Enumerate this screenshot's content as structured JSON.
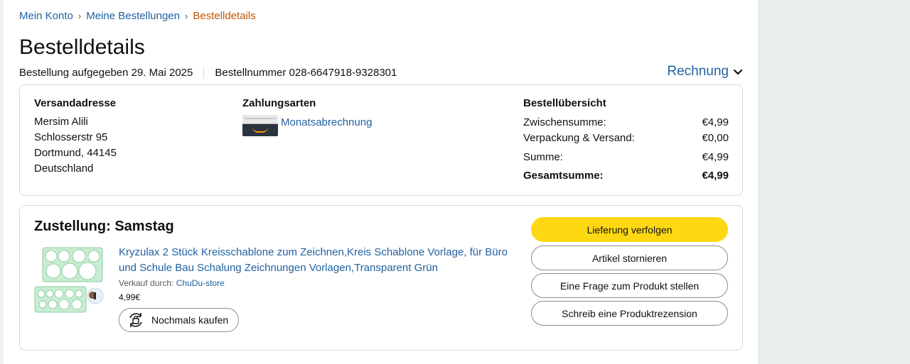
{
  "breadcrumb": {
    "item1": "Mein Konto",
    "item2": "Meine Bestellungen",
    "current": "Bestelldetails",
    "separator": "›"
  },
  "page_title": "Bestelldetails",
  "order": {
    "placed": "Bestellung aufgegeben 29. Mai 2025",
    "number": "Bestellnummer 028-6647918-9328301",
    "invoice_label": "Rechnung"
  },
  "shipping": {
    "title": "Versandadresse",
    "name": "Mersim Alili",
    "street": "Schlosserstr 95",
    "city": "Dortmund, 44145",
    "country": "Deutschland"
  },
  "payment": {
    "title": "Zahlungsarten",
    "method": "Monatsabrechnung"
  },
  "summary": {
    "title": "Bestellübersicht",
    "subtotal_label": "Zwischensumme:",
    "subtotal_value": "€4,99",
    "shipping_label": "Verpackung & Versand:",
    "shipping_value": "€0,00",
    "sum_label": "Summe:",
    "sum_value": "€4,99",
    "total_label": "Gesamtsumme:",
    "total_value": "€4,99"
  },
  "delivery": {
    "title": "Zustellung: Samstag",
    "product_title": "Kryzulax 2 Stück Kreisschablone zum Zeichnen,Kreis Schablone Vorlage, für Büro und Schule Bau Schalung Zeichnungen Vorlagen,Transparent Grün",
    "seller_prefix": "Verkauf durch:",
    "seller_name": "ChuDu-store",
    "price": "4,99€",
    "rebuy_label": "Nochmals kaufen"
  },
  "actions": {
    "track": "Lieferung verfolgen",
    "cancel": "Artikel stornieren",
    "question": "Eine Frage zum Produkt stellen",
    "review": "Schreib eine Produktrezension"
  },
  "colors": {
    "link": "#2162a1",
    "breadcrumb_current": "#c45500",
    "primary_button": "#ffd814",
    "border": "#d5d9d9",
    "gutter": "#eaeded"
  },
  "icons": {
    "invoice_chevron": "chevron-down-icon",
    "payment": "amazon-card-icon",
    "rebuy": "rebuy-cycle-icon"
  }
}
